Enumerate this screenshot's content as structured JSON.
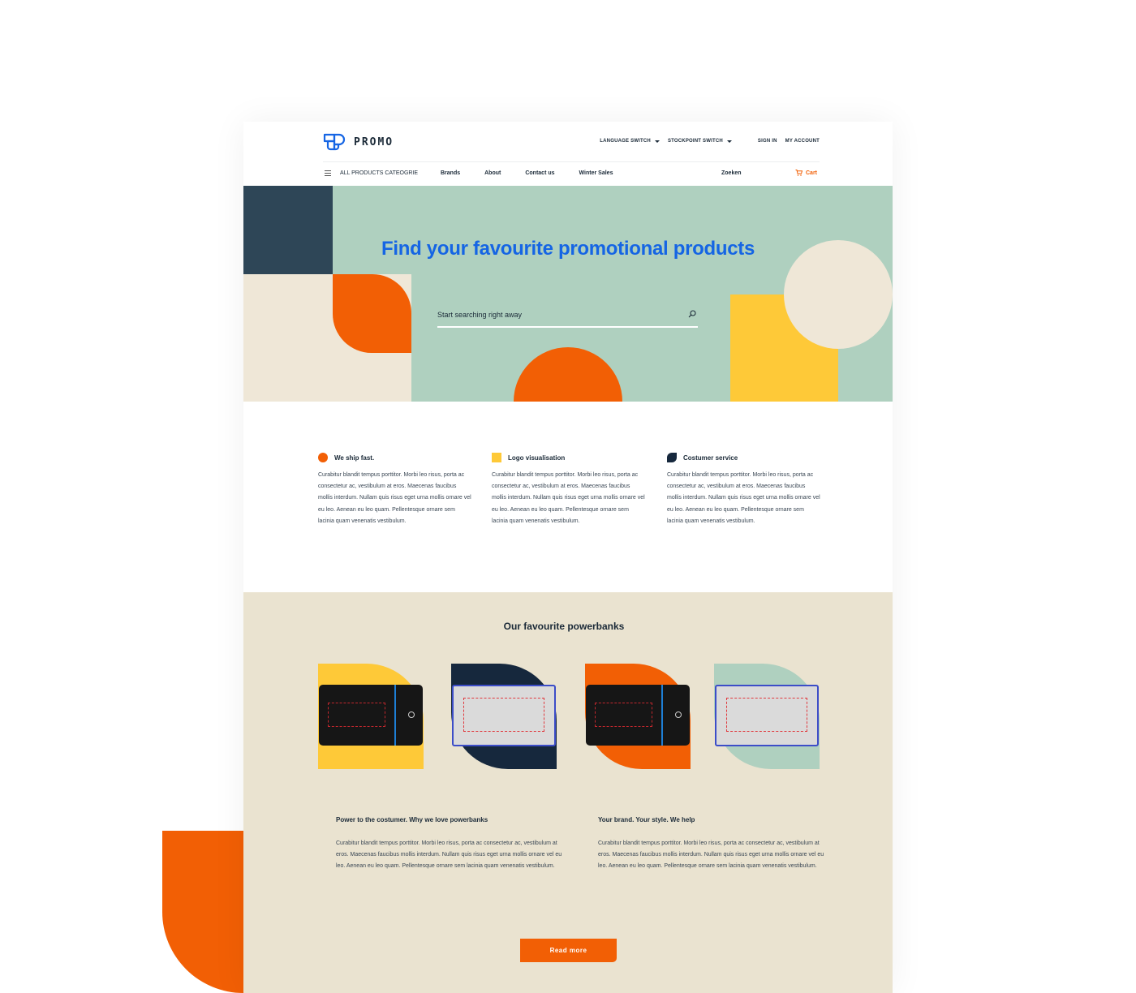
{
  "header": {
    "logo_text": "PROMO",
    "language_switch": "LANGUAGE SWITCH",
    "stockpoint_switch": "STOCKPOINT SWITCH",
    "sign_in": "SIGN IN",
    "my_account": "MY ACCOUNT",
    "all_products": "ALL PRODUCTS CATEOGRIE",
    "nav_links": [
      "Brands",
      "About",
      "Contact us",
      "Winter Sales"
    ],
    "search_link": "Zoeken",
    "cart_label": "Cart"
  },
  "colors": {
    "brand_blue": "#1565e4",
    "accent_orange": "#f25f05",
    "yellow": "#fec938",
    "mint": "#afd0bf",
    "navy": "#16283d",
    "cream": "#eae3d0"
  },
  "hero": {
    "title": "Find your favourite promotional products",
    "search_placeholder": "Start searching right away"
  },
  "features": [
    {
      "icon": "orange-circle-icon",
      "title": "We ship fast.",
      "text": "Curabitur blandit tempus porttitor. Morbi leo risus, porta ac consectetur ac, vestibulum at eros. Maecenas faucibus mollis interdum. Nullam quis risus eget urna mollis ornare vel eu leo. Aenean eu leo quam. Pellentesque ornare sem lacinia quam venenatis vestibulum."
    },
    {
      "icon": "yellow-square-icon",
      "title": "Logo visualisation",
      "text": "Curabitur blandit tempus porttitor. Morbi leo risus, porta ac consectetur ac, vestibulum at eros. Maecenas faucibus mollis interdum. Nullam quis risus eget urna mollis ornare vel eu leo. Aenean eu leo quam. Pellentesque ornare sem lacinia quam venenatis vestibulum."
    },
    {
      "icon": "navy-leaf-icon",
      "title": "Costumer service",
      "text": "Curabitur blandit tempus porttitor. Morbi leo risus, porta ac consectetur ac, vestibulum at eros. Maecenas faucibus mollis interdum. Nullam quis risus eget urna mollis ornare vel eu leo. Aenean eu leo quam. Pellentesque ornare sem lacinia quam venenatis vestibulum."
    }
  ],
  "products": {
    "title": "Our favourite powerbanks",
    "items": [
      {
        "name": "black-powerbank",
        "bg_color": "#fec938"
      },
      {
        "name": "white-powerbank",
        "bg_color": "#16283d"
      },
      {
        "name": "black-powerbank",
        "bg_color": "#f25f05"
      },
      {
        "name": "white-powerbank",
        "bg_color": "#afd0bf"
      }
    ],
    "articles": [
      {
        "title": "Power to the costumer. Why we love powerbanks",
        "text": "Curabitur blandit tempus porttitor. Morbi leo risus, porta ac consectetur ac, vestibulum at eros. Maecenas faucibus mollis interdum. Nullam quis risus eget urna mollis ornare vel eu leo. Aenean eu leo quam. Pellentesque ornare sem lacinia quam venenatis vestibulum."
      },
      {
        "title": "Your brand. Your style. We help",
        "text": "Curabitur blandit tempus porttitor. Morbi leo risus, porta ac consectetur ac, vestibulum at eros. Maecenas faucibus mollis interdum. Nullam quis risus eget urna mollis ornare vel eu leo. Aenean eu leo quam. Pellentesque ornare sem lacinia quam venenatis vestibulum."
      }
    ],
    "read_more": "Read more"
  }
}
